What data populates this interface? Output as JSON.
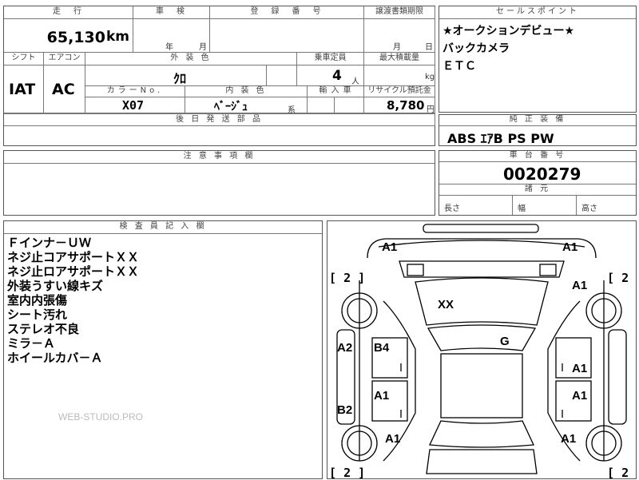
{
  "top": {
    "mileage_header": "走　行",
    "mileage_value": "65,130",
    "mileage_unit": "km",
    "inspection_header": "車　検",
    "inspection_year": "年",
    "inspection_month": "月",
    "registration_header": "登　録　番　号",
    "transfer_header": "譲渡書類期限",
    "transfer_month": "月",
    "transfer_day": "日"
  },
  "row2": {
    "shift_header": "シフト",
    "shift_value": "IAT",
    "ac_header": "エアコン",
    "ac_value": "AC",
    "exterior_header": "外 装 色",
    "exterior_value": "ｸﾛ",
    "capacity_header": "乗車定員",
    "capacity_value": "4",
    "capacity_unit": "人",
    "load_header": "最大積載量",
    "load_unit": "kg",
    "color_no_header": "カラーNo.",
    "color_no_value": "X07",
    "interior_header": "内 装 色",
    "interior_value": "ﾍﾞｰｼﾞｭ",
    "interior_suffix": "系",
    "import_header": "輸 入 車",
    "recycle_header": "リサイクル預託金",
    "recycle_value": "8,780",
    "recycle_unit": "円"
  },
  "delivery": {
    "header": "後 日 発 送 部 品"
  },
  "sales": {
    "header": "セールスポイント",
    "lines": [
      "★オークションデビュー★",
      "バックカメラ",
      "ＥＴＣ"
    ]
  },
  "equipment": {
    "header": "純 正 装 備",
    "value": "ABS ｴｱB PS PW"
  },
  "notes": {
    "header": "注 意 事 項 欄"
  },
  "chassis": {
    "header": "車 台 番 号",
    "value": "0020279",
    "dims_header": "諸 元",
    "length_label": "長さ",
    "width_label": "幅",
    "height_label": "高さ"
  },
  "inspector": {
    "header": "検 査 員 記 入 欄",
    "lines": [
      "Ｆインナ－ＵＷ",
      "ネジ止コアサポートＸＸ",
      "ネジ止ロアサポートＸＸ",
      "外装うすい線キズ",
      "室内内張傷",
      "シート汚れ",
      "ステレオ不良",
      "ミラ－Ａ",
      "ホイールカバ－Ａ"
    ],
    "watermark": "WEB-STUDIO.PRO"
  },
  "diagram": {
    "marks": {
      "front_left": "A1",
      "front_right": "A1",
      "fender_right": "A1",
      "hood": "XX",
      "roof": "G",
      "side_left": "A2",
      "door_front_left": "B4",
      "door_front_right": "A1",
      "door_rear_left": "A1",
      "door_rear_right": "A1",
      "rear_side_left": "B2",
      "rear_left": "A1",
      "rear_right": "A1"
    },
    "tires": {
      "front_left": "2",
      "front_right": "2",
      "rear_left": "2",
      "rear_right": "2"
    }
  }
}
